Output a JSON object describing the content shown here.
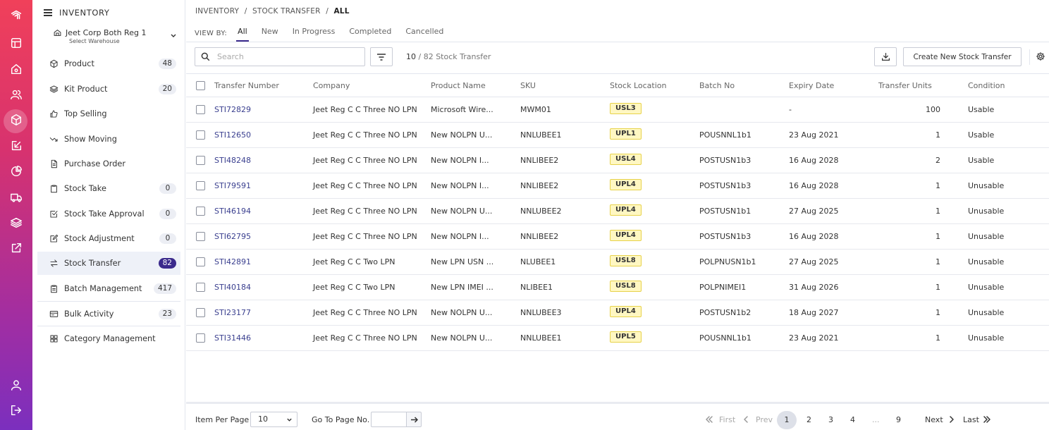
{
  "sidebar": {
    "section_title": "INVENTORY",
    "warehouse": {
      "name": "Jeet Corp Both Reg 1",
      "sub_label": "Select Warehouse"
    },
    "items": [
      {
        "label": "Product",
        "count": "48",
        "icon": "cube-icon"
      },
      {
        "label": "Kit Product",
        "count": "20",
        "icon": "layers-icon"
      },
      {
        "label": "Top Selling",
        "count": "",
        "icon": "thumbs-up-icon"
      },
      {
        "label": "Show Moving",
        "count": "",
        "icon": "trend-down-icon"
      },
      {
        "label": "Purchase Order",
        "count": "",
        "icon": "document-icon"
      },
      {
        "label": "Stock Take",
        "count": "0",
        "icon": "clipboard-icon"
      },
      {
        "label": "Stock Take Approval",
        "count": "0",
        "icon": "check-square-icon"
      },
      {
        "label": "Stock Adjustment",
        "count": "0",
        "icon": "edit-icon"
      },
      {
        "label": "Stock Transfer",
        "count": "82",
        "icon": "transfer-icon",
        "active": true
      },
      {
        "label": "Batch Management",
        "count": "417",
        "icon": "clipboard-list-icon"
      },
      {
        "label": "Bulk Activity",
        "count": "23",
        "icon": "card-icon"
      },
      {
        "label": "Category Management",
        "count": "",
        "icon": "grid-icon"
      }
    ]
  },
  "breadcrumb": {
    "part1": "INVENTORY",
    "sep": "/",
    "part2": "STOCK TRANSFER",
    "part3": "ALL"
  },
  "view_by": {
    "label": "VIEW BY:",
    "tabs": [
      "All",
      "New",
      "In Progress",
      "Completed",
      "Cancelled"
    ],
    "active": "All"
  },
  "toolbar": {
    "search_placeholder": "Search",
    "count_shown": "10",
    "count_total": "/ 82 Stock Transfer",
    "create_label": "Create New Stock Transfer"
  },
  "table": {
    "columns": [
      "Transfer Number",
      "Company",
      "Product Name",
      "SKU",
      "Stock Location",
      "Batch No",
      "Expiry Date",
      "Transfer Units",
      "Condition"
    ],
    "rows": [
      {
        "transfer": "STI72829",
        "company": "Jeet Reg C C Three NO LPN",
        "product": "Microsoft Wire...",
        "sku": "MWM01",
        "location": "USL3",
        "batch": "",
        "expiry": "-",
        "units": "100",
        "condition": "Usable"
      },
      {
        "transfer": "STI12650",
        "company": "Jeet Reg C C Three NO LPN",
        "product": "New NOLPN U...",
        "sku": "NNLUBEE1",
        "location": "UPL1",
        "batch": "POUSNNL1b1",
        "expiry": "23 Aug 2021",
        "units": "1",
        "condition": "Usable"
      },
      {
        "transfer": "STI48248",
        "company": "Jeet Reg C C Three NO LPN",
        "product": "New NOLPN I...",
        "sku": "NNLIBEE2",
        "location": "USL4",
        "batch": "POSTUSN1b3",
        "expiry": "16 Aug 2028",
        "units": "2",
        "condition": "Usable"
      },
      {
        "transfer": "STI79591",
        "company": "Jeet Reg C C Three NO LPN",
        "product": "New NOLPN I...",
        "sku": "NNLIBEE2",
        "location": "UPL4",
        "batch": "POSTUSN1b3",
        "expiry": "16 Aug 2028",
        "units": "1",
        "condition": "Unusable"
      },
      {
        "transfer": "STI46194",
        "company": "Jeet Reg C C Three NO LPN",
        "product": "New NOLPN U...",
        "sku": "NNLUBEE2",
        "location": "UPL4",
        "batch": "POSTUSN1b1",
        "expiry": "27 Aug 2025",
        "units": "1",
        "condition": "Unusable"
      },
      {
        "transfer": "STI62795",
        "company": "Jeet Reg C C Three NO LPN",
        "product": "New NOLPN I...",
        "sku": "NNLIBEE2",
        "location": "UPL4",
        "batch": "POSTUSN1b3",
        "expiry": "16 Aug 2028",
        "units": "1",
        "condition": "Unusable"
      },
      {
        "transfer": "STI42891",
        "company": "Jeet Reg C C Two LPN",
        "product": "New LPN USN ...",
        "sku": "NLUBEE1",
        "location": "USL8",
        "batch": "POLPNUSN1b1",
        "expiry": "27 Aug 2025",
        "units": "1",
        "condition": "Unusable"
      },
      {
        "transfer": "STI40184",
        "company": "Jeet Reg C C Two LPN",
        "product": "New LPN IMEI ...",
        "sku": "NLIBEE1",
        "location": "USL8",
        "batch": "POLPNIMEI1",
        "expiry": "31 Aug 2026",
        "units": "1",
        "condition": "Unusable"
      },
      {
        "transfer": "STI23177",
        "company": "Jeet Reg C C Three NO LPN",
        "product": "New NOLPN U...",
        "sku": "NNLUBEE3",
        "location": "UPL4",
        "batch": "POSTUSN1b2",
        "expiry": "18 Aug 2027",
        "units": "1",
        "condition": "Unusable"
      },
      {
        "transfer": "STI31446",
        "company": "Jeet Reg C C Three NO LPN",
        "product": "New NOLPN U...",
        "sku": "NNLUBEE1",
        "location": "UPL5",
        "batch": "POUSNNL1b1",
        "expiry": "23 Aug 2021",
        "units": "1",
        "condition": "Unusable"
      }
    ]
  },
  "footer": {
    "items_per_page_label": "Item Per Page",
    "items_per_page_value": "10",
    "goto_label": "Go To Page No.",
    "first": "First",
    "prev": "Prev",
    "pages": [
      "1",
      "2",
      "3",
      "4",
      "...",
      "9"
    ],
    "current_page": "1",
    "next": "Next",
    "last": "Last"
  },
  "colors": {
    "rail_top": "#f0405a",
    "rail_bottom": "#7b2fbe",
    "accent": "#3b2a8c",
    "location_tag_bg": "#fff7c2",
    "link": "#3a3f8f"
  }
}
